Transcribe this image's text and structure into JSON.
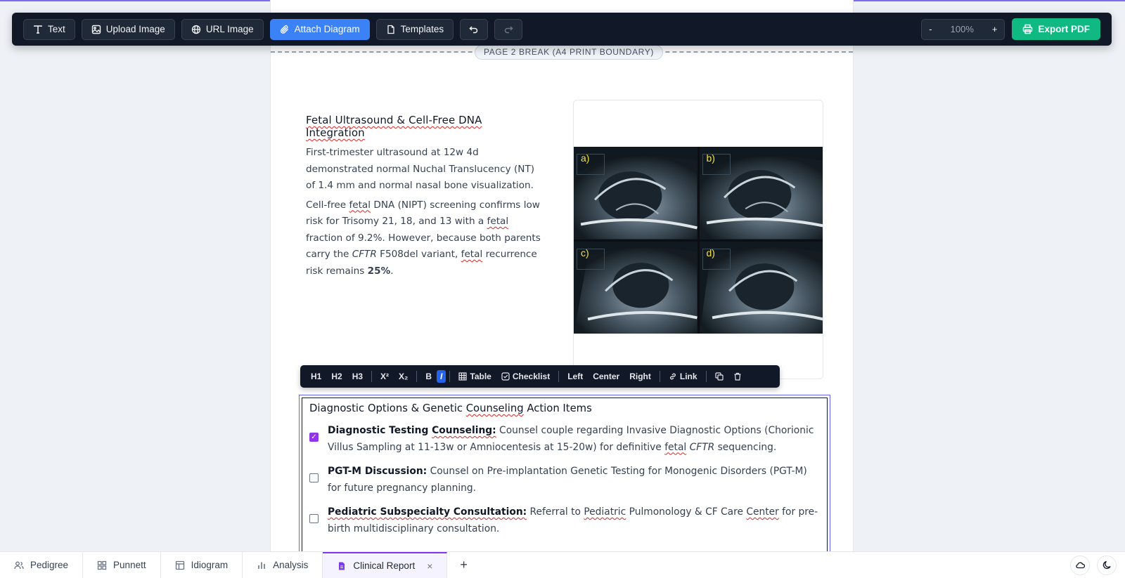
{
  "toolbar": {
    "text_label": "Text",
    "upload_image_label": "Upload Image",
    "url_image_label": "URL Image",
    "attach_diagram_label": "Attach Diagram",
    "templates_label": "Templates",
    "zoom_minus": "-",
    "zoom_value": "100%",
    "zoom_plus": "+",
    "export_label": "Export PDF"
  },
  "page_break": {
    "label": "PAGE 2 BREAK (A4 PRINT BOUNDARY)"
  },
  "section": {
    "title": "Fetal Ultrasound & Cell-Free DNA Integration",
    "para1": "First-trimester ultrasound at 12w 4d demonstrated normal Nuchal Translucency (NT) of 1.4 mm and normal nasal bone visualization.",
    "para2_part1": "Cell-free ",
    "para2_fetal1": "fetal",
    "para2_part2": " DNA (NIPT) screening confirms low risk for Trisomy 21, 18, and 13 with a ",
    "para2_fetal2": "fetal",
    "para2_part3": " fraction of 9.2%. However, because both parents carry the ",
    "para2_gene": "CFTR",
    "para2_part4": " F508del variant, ",
    "para2_fetal3": "fetal",
    "para2_part5": " recurrence risk remains ",
    "para2_risk": "25%",
    "para2_end": "."
  },
  "figure": {
    "panel_labels": [
      "a)",
      "b)",
      "c)",
      "d)"
    ]
  },
  "format_bar": {
    "h1": "H1",
    "h2": "H2",
    "h3": "H3",
    "sup": "X²",
    "sub": "X₂",
    "bold": "B",
    "italic": "I",
    "table": "Table",
    "checklist": "Checklist",
    "left": "Left",
    "center": "Center",
    "right": "Right",
    "link": "Link"
  },
  "checklist": {
    "title_part1": "Diagnostic Options & Genetic ",
    "title_squig": "Counseling",
    "title_part2": " Action Items",
    "items": [
      {
        "checked": true,
        "bold_a": "Diagnostic Testing ",
        "bold_squig": "Counseling:",
        "text_a": " Counsel couple regarding Invasive Diagnostic Options (Chorionic Villus Sampling at 11-13w or Amniocentesis at 15-20w) for definitive ",
        "text_squig": "fetal",
        "text_gap": " ",
        "text_gene": "CFTR",
        "text_b": " sequencing."
      },
      {
        "checked": false,
        "bold": "PGT-M Discussion:",
        "text": " Counsel on Pre-implantation Genetic Testing for Monogenic Disorders (PGT-M) for future pregnancy planning."
      },
      {
        "checked": false,
        "bold": "Pediatric Subspecialty Consultation:",
        "text_a": " Referral to ",
        "text_squig1": "Pediatric",
        "text_b": " Pulmonology & CF Care ",
        "text_squig2": "Center",
        "text_c": " for pre-birth multidisciplinary consultation."
      }
    ]
  },
  "tabs": [
    {
      "label": "Pedigree",
      "icon": "users-icon"
    },
    {
      "label": "Punnett",
      "icon": "grid-icon"
    },
    {
      "label": "Idiogram",
      "icon": "table-icon"
    },
    {
      "label": "Analysis",
      "icon": "bar-chart-icon"
    },
    {
      "label": "Clinical Report",
      "icon": "document-icon",
      "active": true,
      "close": "×"
    }
  ],
  "tab_add": "+",
  "colors": {
    "accent": "#3b82f6",
    "export": "#10b981",
    "checked": "#9333ea",
    "active_tab": "#7c3aed",
    "toolbar_bg": "#111827"
  }
}
